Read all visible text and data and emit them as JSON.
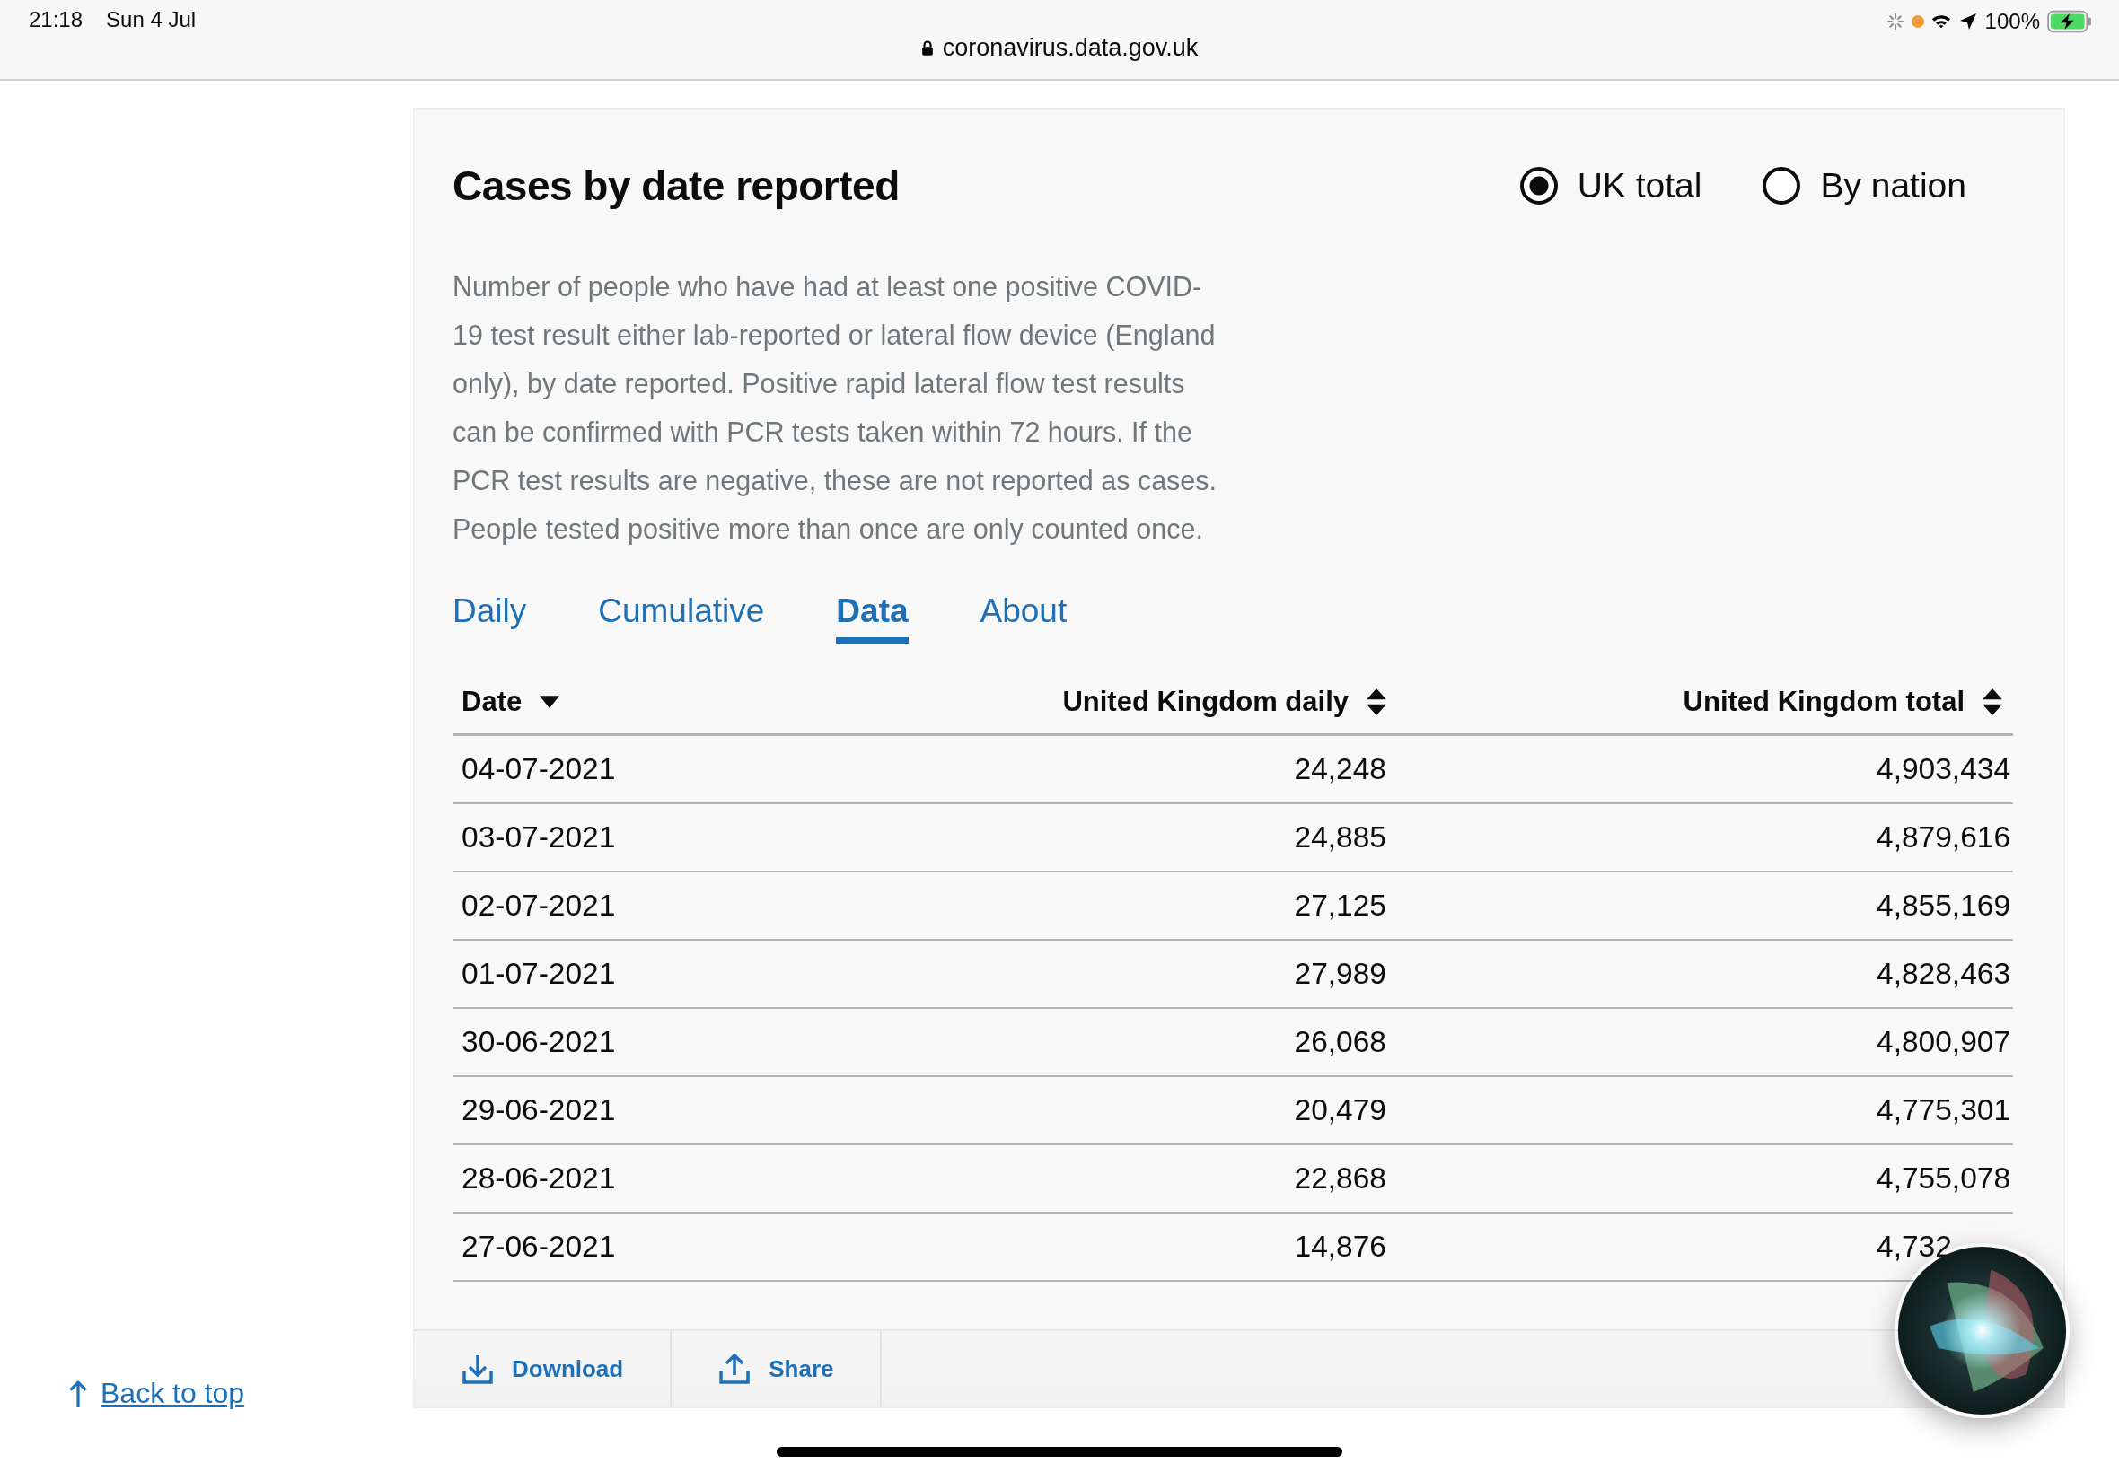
{
  "status_bar": {
    "time": "21:18",
    "date": "Sun 4 Jul",
    "url": "coronavirus.data.gov.uk",
    "battery": "100%"
  },
  "card": {
    "title": "Cases by date reported",
    "view_options": [
      {
        "label": "UK total",
        "selected": true
      },
      {
        "label": "By nation",
        "selected": false
      }
    ],
    "description": "Number of people who have had at least one positive COVID-19 test result either lab-reported or lateral flow device (England only), by date reported. Positive rapid lateral flow test results can be confirmed with PCR tests taken within 72 hours. If the PCR test results are negative, these are not reported as cases. People tested positive more than once are only counted once.",
    "tabs": [
      {
        "label": "Daily",
        "selected": false
      },
      {
        "label": "Cumulative",
        "selected": false
      },
      {
        "label": "Data",
        "selected": true
      },
      {
        "label": "About",
        "selected": false
      }
    ],
    "table": {
      "columns": [
        {
          "label": "Date",
          "sorted": true
        },
        {
          "label": "United Kingdom daily",
          "sorted": false
        },
        {
          "label": "United Kingdom total",
          "sorted": false
        }
      ],
      "rows": [
        [
          "04-07-2021",
          "24,248",
          "4,903,434"
        ],
        [
          "03-07-2021",
          "24,885",
          "4,879,616"
        ],
        [
          "02-07-2021",
          "27,125",
          "4,855,169"
        ],
        [
          "01-07-2021",
          "27,989",
          "4,828,463"
        ],
        [
          "30-06-2021",
          "26,068",
          "4,800,907"
        ],
        [
          "29-06-2021",
          "20,479",
          "4,775,301"
        ],
        [
          "28-06-2021",
          "22,868",
          "4,755,078"
        ],
        [
          "27-06-2021",
          "14,876",
          "4,732"
        ]
      ]
    },
    "actions": [
      {
        "label": "Download",
        "kind": "download"
      },
      {
        "label": "Share",
        "kind": "share"
      }
    ]
  },
  "back_to_top": "Back to top"
}
